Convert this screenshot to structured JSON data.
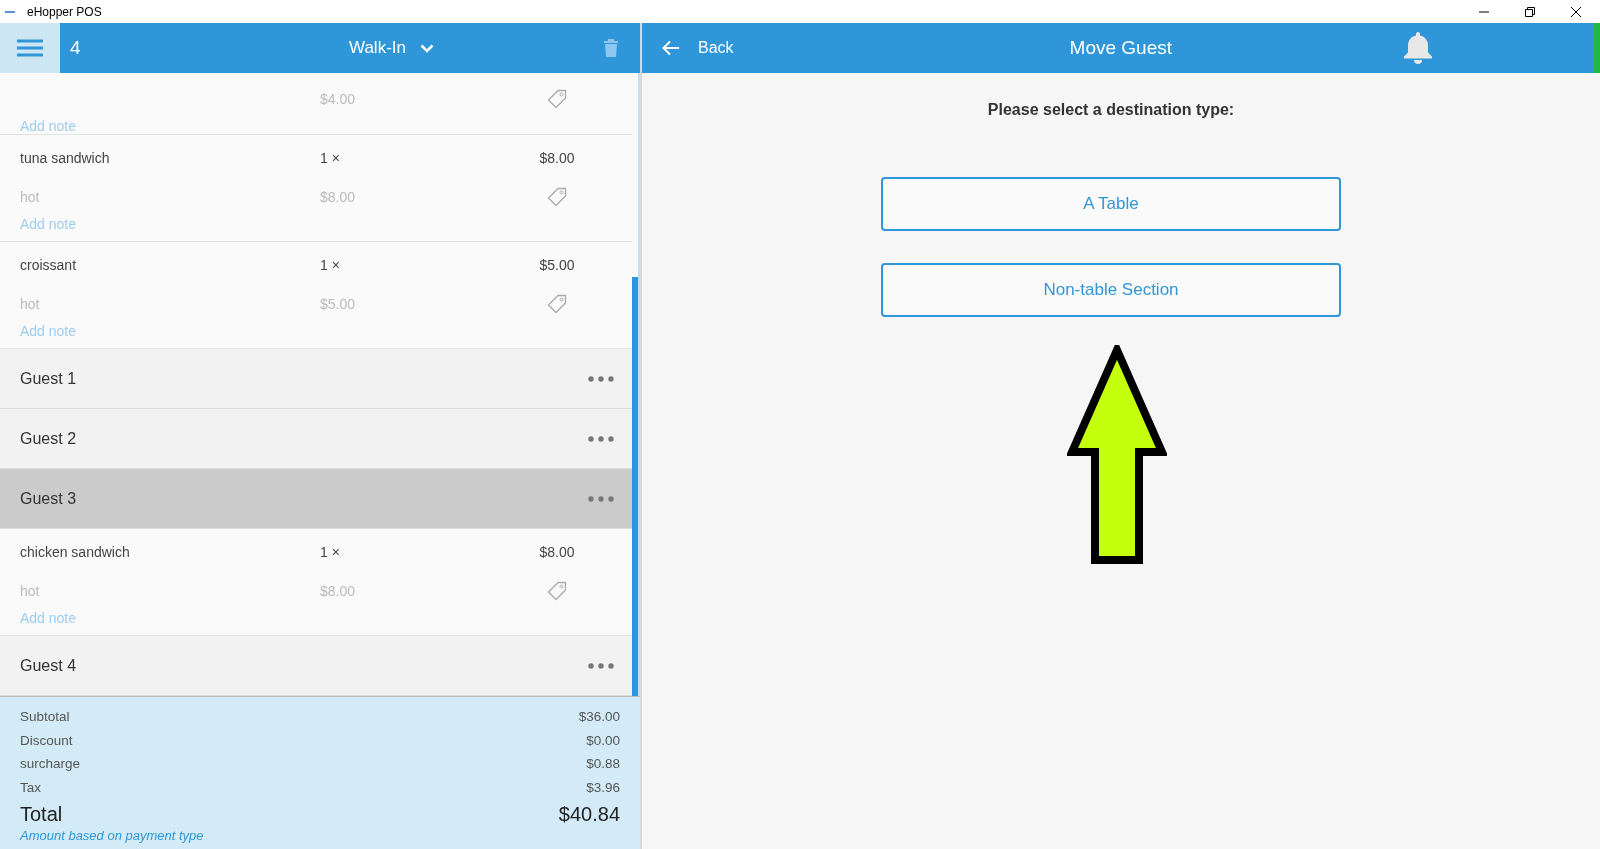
{
  "window": {
    "title": "eHopper POS"
  },
  "order_header": {
    "number": "4",
    "order_type": "Walk-In"
  },
  "order_lines": [
    {
      "kind": "item",
      "unit_price": "$4.00",
      "note_link": "Add note"
    },
    {
      "kind": "item",
      "name": "tuna sandwich",
      "qty": "1 ×",
      "price": "$8.00",
      "modifier": "hot",
      "unit_price": "$8.00",
      "note_link": "Add note"
    },
    {
      "kind": "item",
      "name": "croissant",
      "qty": "1 ×",
      "price": "$5.00",
      "modifier": "hot",
      "unit_price": "$5.00",
      "note_link": "Add note"
    },
    {
      "kind": "guest",
      "name": "Guest 1",
      "selected": false
    },
    {
      "kind": "guest",
      "name": "Guest 2",
      "selected": false
    },
    {
      "kind": "guest",
      "name": "Guest 3",
      "selected": true
    },
    {
      "kind": "item",
      "name": "chicken sandwich",
      "qty": "1 ×",
      "price": "$8.00",
      "modifier": "hot",
      "unit_price": "$8.00",
      "note_link": "Add note"
    },
    {
      "kind": "guest",
      "name": "Guest 4",
      "selected": false
    }
  ],
  "summary": {
    "rows": [
      {
        "label": "Subtotal",
        "value": "$36.00"
      },
      {
        "label": "Discount",
        "value": "$0.00"
      },
      {
        "label": "surcharge",
        "value": "$0.88"
      },
      {
        "label": "Tax",
        "value": "$3.96"
      }
    ],
    "total_label": "Total",
    "total_value": "$40.84",
    "note": "Amount based on payment type"
  },
  "move_panel": {
    "back": "Back",
    "title": "Move Guest",
    "prompt": "Please select a destination type:",
    "options": [
      "A Table",
      "Non-table Section"
    ]
  }
}
